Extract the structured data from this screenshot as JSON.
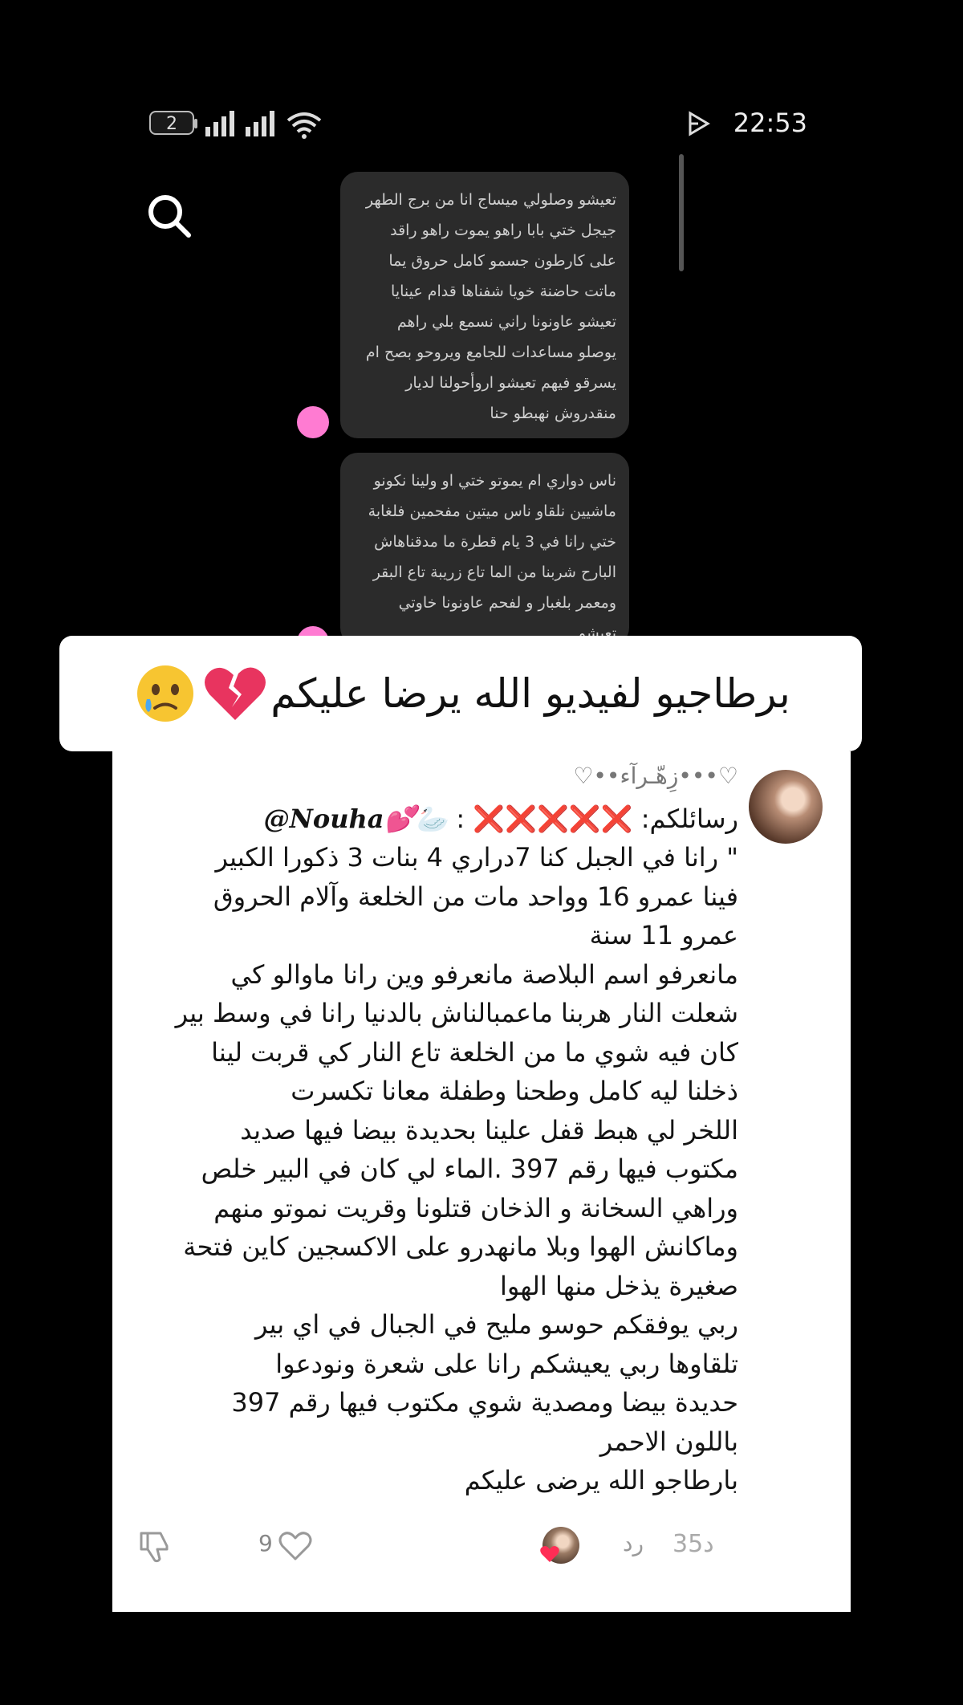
{
  "status_bar": {
    "sim_number": "2",
    "time": "22:53"
  },
  "chat": {
    "bubble1_lines": [
      "تعيشو وصلولي ميساج انا من برج الطهر",
      "جيجل ختي بابا راهو يموت راهو راقد",
      "على كارطون جسمو كامل حروق يما",
      "ماتت حاضنة خويا شفناها قدام عينايا",
      "تعيشو عاونونا راني نسمع بلي راهم",
      "يوصلو مساعدات للجامع ويروحو بصح ام",
      "يسرقو فيهم تعيشو اروأحولنا لديار",
      "منقدروش نهبطو حنا"
    ],
    "bubble2_lines": [
      "ناس دواري ام يموتو ختي او ولينا نكونو",
      "ماشيين نلقاو ناس ميتين مفحمين فلغابة",
      "ختي رانا في 3 يام قطرة ما مدقناهاش",
      "البارح شربنا من الما تاع زريبة تاع البقر",
      "ومعمر بلغبار و لفحم عاونونا خاوتي",
      "تعيشو"
    ]
  },
  "banner": {
    "text": "برطاجيو لفيديو الله يرضا عليكم"
  },
  "comment": {
    "username": "♡••زِهّـرآء•••♡",
    "header_prefix": "رسائلكم:",
    "header_x": "❌❌❌❌❌",
    "header_colon": ":",
    "mention": "@Nouha💕🦢",
    "lines": [
      "\" رانا في الجبل كنا 7دراري 4 بنات 3 ذكورا الكبير",
      "فينا عمرو 16 وواحد مات من الخلعة وآلام الحروق",
      "عمرو 11 سنة",
      "مانعرفو اسم البلاصة مانعرفو وين رانا ماوالو كي",
      "شعلت النار هربنا ماعمبالناش بالدنيا رانا في وسط بير",
      "كان فيه شوي ما من الخلعة تاع النار كي قربت لينا",
      "ذخلنا ليه كامل وطحنا وطفلة معانا تكسرت",
      "اللخر لي هبط قفل علينا بحديدة بيضا فيها صديد",
      "مكتوب فيها رقم 397 .الماء لي كان في البير خلص",
      "وراهي السخانة و الذخان قتلونا وقريت نموتو منهم",
      "وماكانش الهوا وبلا مانهدرو على الاكسجين كاين فتحة",
      "صغيرة يذخل منها الهوا",
      "ربي يوفقكم حوسو مليح في الجبال في اي بير",
      "تلقاوها ربي يعيشكم رانا على شعرة ونودعوا",
      "حديدة بيضا ومصدية شوي مكتوب فيها رقم 397",
      "باللون الاحمر",
      "بارطاجو الله يرضى عليكم"
    ],
    "like_count": "9",
    "reply_label": "رد",
    "age": "35د"
  },
  "colors": {
    "accent_pink": "#ff7bd2",
    "x_red": "#e63b3b"
  }
}
